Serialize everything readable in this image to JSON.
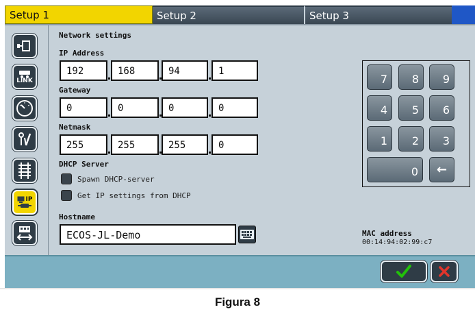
{
  "tabs": [
    {
      "label": "Setup 1",
      "active": true
    },
    {
      "label": "Setup 2",
      "active": false
    },
    {
      "label": "Setup 3",
      "active": false
    }
  ],
  "sidebar": {
    "items": [
      {
        "icon": "connector-icon"
      },
      {
        "icon": "link-icon",
        "label": "LINK"
      },
      {
        "icon": "gauge-icon"
      },
      {
        "icon": "signal-tools-icon"
      },
      {
        "icon": "track-icon"
      },
      {
        "icon": "network-ip-icon",
        "label": "IP",
        "active": true
      },
      {
        "icon": "transfer-icon"
      }
    ]
  },
  "network": {
    "title": "Network settings",
    "ip_label": "IP Address",
    "ip": [
      "192",
      "168",
      "94",
      "1"
    ],
    "gateway_label": "Gateway",
    "gateway": [
      "0",
      "0",
      "0",
      "0"
    ],
    "netmask_label": "Netmask",
    "netmask": [
      "255",
      "255",
      "255",
      "0"
    ]
  },
  "dhcp": {
    "title": "DHCP Server",
    "spawn_label": "Spawn DHCP-server",
    "get_label": "Get IP settings from DHCP"
  },
  "hostname": {
    "label": "Hostname",
    "value": "ECOS-JL-Demo"
  },
  "mac": {
    "label": "MAC address",
    "value": "00:14:94:02:99:c7"
  },
  "keypad": {
    "keys": [
      "7",
      "8",
      "9",
      "4",
      "5",
      "6",
      "1",
      "2",
      "3",
      "0"
    ],
    "backspace": "←"
  },
  "footer": {
    "ok_icon": "checkmark-icon",
    "cancel_icon": "close-icon"
  },
  "caption": "Figura 8",
  "colors": {
    "tab_active": "#f2d500",
    "content_bg": "#c6d1d9",
    "footer_bg": "#7cb0c2",
    "ok": "#22c00a",
    "cancel": "#e2352b"
  }
}
